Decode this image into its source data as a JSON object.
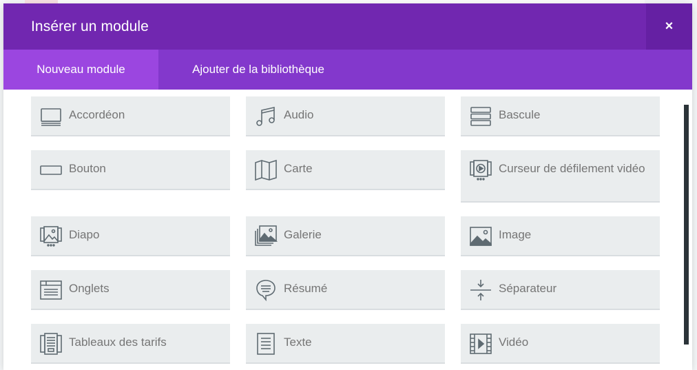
{
  "modal": {
    "title": "Insérer un module",
    "close_label": "×"
  },
  "tabs": [
    {
      "label": "Nouveau module",
      "active": true
    },
    {
      "label": "Ajouter de la bibliothèque",
      "active": false
    }
  ],
  "modules": [
    {
      "label": "Accordéon",
      "icon": "accordion-icon"
    },
    {
      "label": "Audio",
      "icon": "music-note-icon"
    },
    {
      "label": "Bascule",
      "icon": "toggle-icon"
    },
    {
      "label": "Bouton",
      "icon": "button-icon"
    },
    {
      "label": "Carte",
      "icon": "map-icon"
    },
    {
      "label": "Curseur de défilement vidéo",
      "icon": "video-slider-icon"
    },
    {
      "label": "Diapo",
      "icon": "slider-icon"
    },
    {
      "label": "Galerie",
      "icon": "gallery-icon"
    },
    {
      "label": "Image",
      "icon": "image-icon"
    },
    {
      "label": "Onglets",
      "icon": "tabs-icon"
    },
    {
      "label": "Résumé",
      "icon": "blurb-icon"
    },
    {
      "label": "Séparateur",
      "icon": "divider-icon"
    },
    {
      "label": "Tableaux des tarifs",
      "icon": "pricing-tables-icon"
    },
    {
      "label": "Texte",
      "icon": "text-icon"
    },
    {
      "label": "Vidéo",
      "icon": "video-icon"
    }
  ],
  "colors": {
    "header": "#7127b0",
    "tabbar": "#8338cc",
    "active_tab": "#9b46e0",
    "module_bg": "#eaedee",
    "icon": "#5f6b72",
    "label": "#757575"
  }
}
